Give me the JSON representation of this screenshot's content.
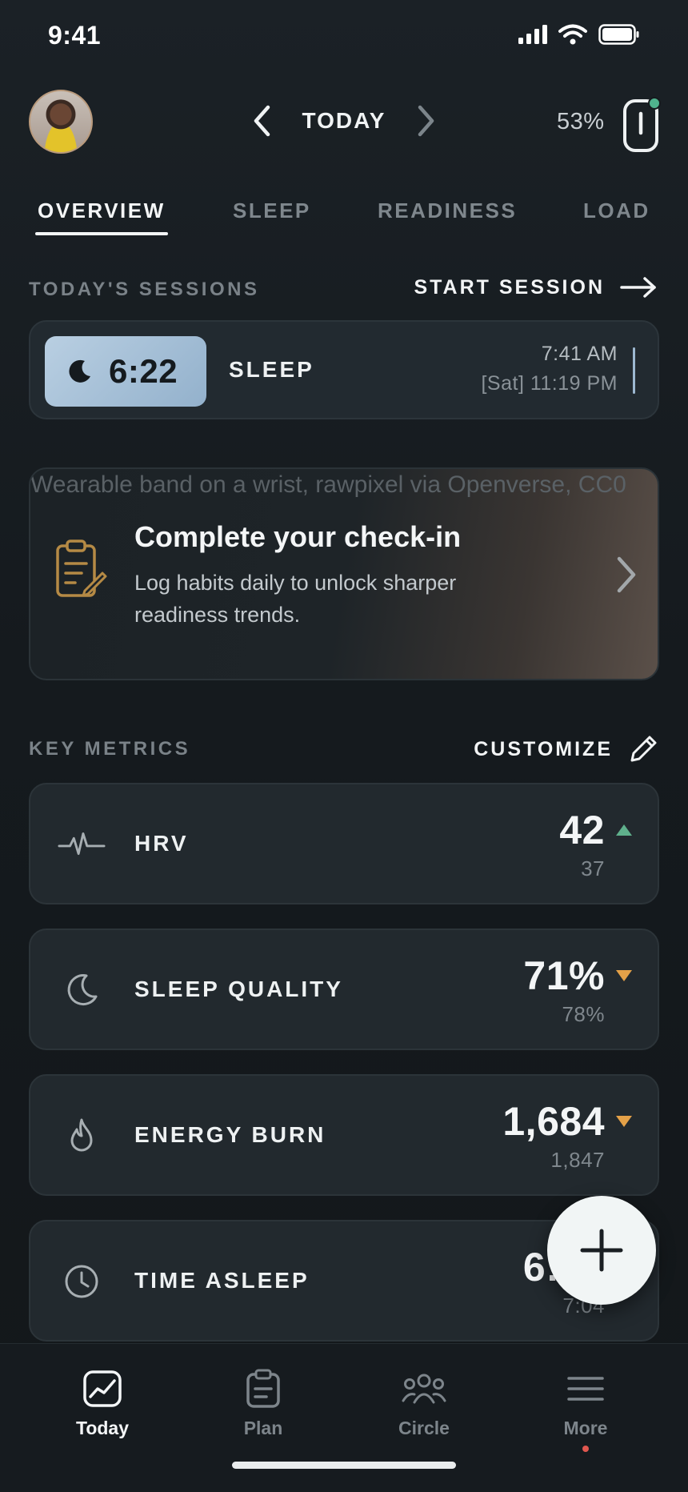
{
  "status_bar": {
    "time": "9:41"
  },
  "header": {
    "date_label": "TODAY",
    "battery_percent": "53%"
  },
  "tabs": [
    {
      "label": "OVERVIEW",
      "active": true
    },
    {
      "label": "SLEEP",
      "active": false
    },
    {
      "label": "READINESS",
      "active": false
    },
    {
      "label": "LOAD",
      "active": false
    }
  ],
  "sessions": {
    "title": "TODAY'S SESSIONS",
    "action_label": "START SESSION",
    "items": [
      {
        "duration": "6:22",
        "type": "SLEEP",
        "end_time": "7:41 AM",
        "start_time": "[Sat] 11:19 PM",
        "color": "#9db8d1"
      }
    ]
  },
  "checkin": {
    "image_alt": "Wearable band on a wrist, rawpixel via Openverse, CC0",
    "title": "Complete your check-in",
    "description": "Log habits daily to unlock sharper readiness trends.",
    "icon": "clipboard-icon"
  },
  "metrics": {
    "title": "KEY METRICS",
    "action_label": "CUSTOMIZE",
    "items": [
      {
        "label": "HRV",
        "value": "42",
        "baseline": "37",
        "trend": "up",
        "icon": "heartbeat-icon"
      },
      {
        "label": "SLEEP QUALITY",
        "value": "71%",
        "baseline": "78%",
        "trend": "down",
        "icon": "moon-icon"
      },
      {
        "label": "ENERGY BURN",
        "value": "1,684",
        "baseline": "1,847",
        "trend": "down",
        "icon": "flame-icon"
      },
      {
        "label": "TIME ASLEEP",
        "value": "6:22",
        "baseline": "7:04",
        "trend": "down",
        "icon": "clock-icon"
      }
    ]
  },
  "bottom_nav": [
    {
      "label": "Today",
      "icon": "chart-icon",
      "active": true
    },
    {
      "label": "Plan",
      "icon": "clipboard-icon",
      "active": false
    },
    {
      "label": "Circle",
      "icon": "people-icon",
      "active": false
    },
    {
      "label": "More",
      "icon": "menu-icon",
      "active": false,
      "notification": true
    }
  ],
  "colors": {
    "accent_up": "#5fb08c",
    "accent_down": "#e4a148",
    "sleep_accent": "#9db8d1",
    "notification": "#e0574f"
  }
}
